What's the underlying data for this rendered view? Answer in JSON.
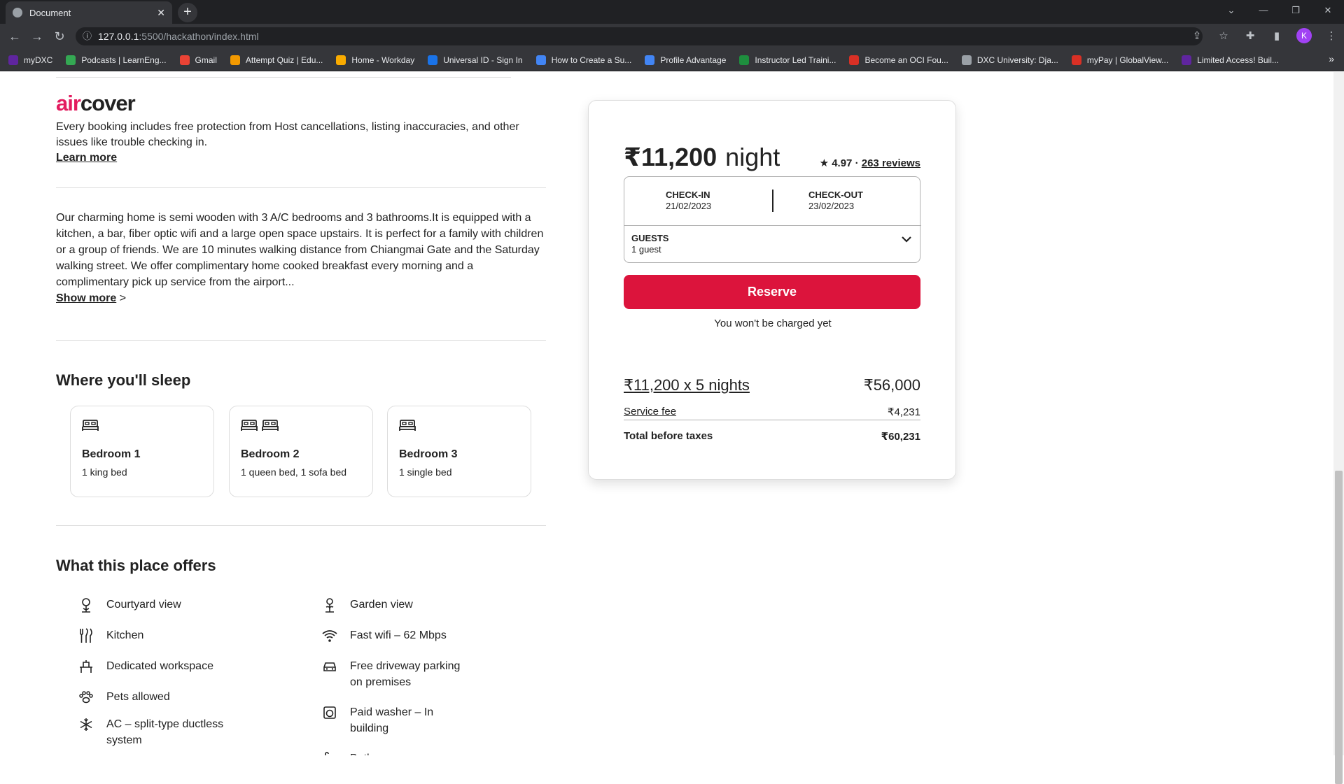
{
  "browser": {
    "tab_title": "Document",
    "tab_close": "✕",
    "new_tab": "+",
    "url_host": "127.0.0.1",
    "url_path": ":5500/hackathon/index.html",
    "profile_initial": "K",
    "bookmarks": [
      {
        "label": "myDXC",
        "color": "#5f259f"
      },
      {
        "label": "Podcasts | LearnEng...",
        "color": "#34a853"
      },
      {
        "label": "Gmail",
        "color": "#ea4335"
      },
      {
        "label": "Attempt Quiz | Edu...",
        "color": "#f29900"
      },
      {
        "label": "Home - Workday",
        "color": "#f9ab00"
      },
      {
        "label": "Universal ID - Sign In",
        "color": "#1a73e8"
      },
      {
        "label": "How to Create a Su...",
        "color": "#4285f4"
      },
      {
        "label": "Profile Advantage",
        "color": "#4285f4"
      },
      {
        "label": "Instructor Led Traini...",
        "color": "#1e8e3e"
      },
      {
        "label": "Become an OCI Fou...",
        "color": "#d93025"
      },
      {
        "label": "DXC University: Dja...",
        "color": "#9aa0a6"
      },
      {
        "label": "myPay | GlobalView...",
        "color": "#d93025"
      },
      {
        "label": "Limited Access! Buil...",
        "color": "#5f259f"
      }
    ],
    "bookmarks_more": "»"
  },
  "listing": {
    "brand_air": "air",
    "brand_cover": "cover",
    "aircover_text": "Every booking includes free protection from Host cancellations, listing inaccuracies, and other issues like trouble checking in.",
    "learn_more": "Learn more",
    "description": "Our charming home is semi wooden with 3 A/C bedrooms and 3 bathrooms.It is equipped with a kitchen, a bar, fiber optic wifi and a large open space upstairs. It is perfect for a family with children or a group of friends. We are 10 minutes walking distance from Chiangmai Gate and the Saturday walking street. We offer complimentary home cooked breakfast every morning and a complimentary pick up service from the airport...",
    "show_more": "Show more",
    "show_more_arrow": ">",
    "sleep_heading": "Where you'll sleep",
    "bedrooms": [
      {
        "title": "Bedroom 1",
        "beds": "1 king bed",
        "icons": 1
      },
      {
        "title": "Bedroom 2",
        "beds": "1 queen bed, 1 sofa bed",
        "icons": 2
      },
      {
        "title": "Bedroom 3",
        "beds": "1 single bed",
        "icons": 1
      }
    ],
    "offers_heading": "What this place offers",
    "amenities_left": [
      {
        "label": "Courtyard view",
        "icon": "courtyard-icon"
      },
      {
        "label": "Kitchen",
        "icon": "kitchen-icon"
      },
      {
        "label": "Dedicated workspace",
        "icon": "workspace-icon"
      },
      {
        "label": "Pets allowed",
        "icon": "paw-icon"
      },
      {
        "label": "AC – split-type ductless system",
        "icon": "snowflake-icon"
      }
    ],
    "amenities_right": [
      {
        "label": "Garden view",
        "icon": "garden-icon"
      },
      {
        "label": "Fast wifi – 62 Mbps",
        "icon": "wifi-icon"
      },
      {
        "label": "Free driveway parking on premises",
        "icon": "car-icon"
      },
      {
        "label": "Paid washer – In building",
        "icon": "washer-icon"
      },
      {
        "label": "Bath",
        "icon": "bath-icon"
      }
    ]
  },
  "booking": {
    "price": "₹11,200",
    "per": "night",
    "rating": "★ 4.97 ·",
    "reviews": "263 reviews",
    "checkin_label": "CHECK-IN",
    "checkin_value": "21/02/2023",
    "checkout_label": "CHECK-OUT",
    "checkout_value": "23/02/2023",
    "guests_label": "GUESTS",
    "guests_value": "1 guest",
    "reserve_label": "Reserve",
    "no_charge": "You won't be charged yet",
    "nights_label": "₹11,200 x 5 nights",
    "nights_total": "₹56,000",
    "service_label": "Service fee",
    "service_total": "₹4,231",
    "total_label": "Total before taxes",
    "total_value": "₹60,231",
    "reserve_color": "#dc143c"
  }
}
